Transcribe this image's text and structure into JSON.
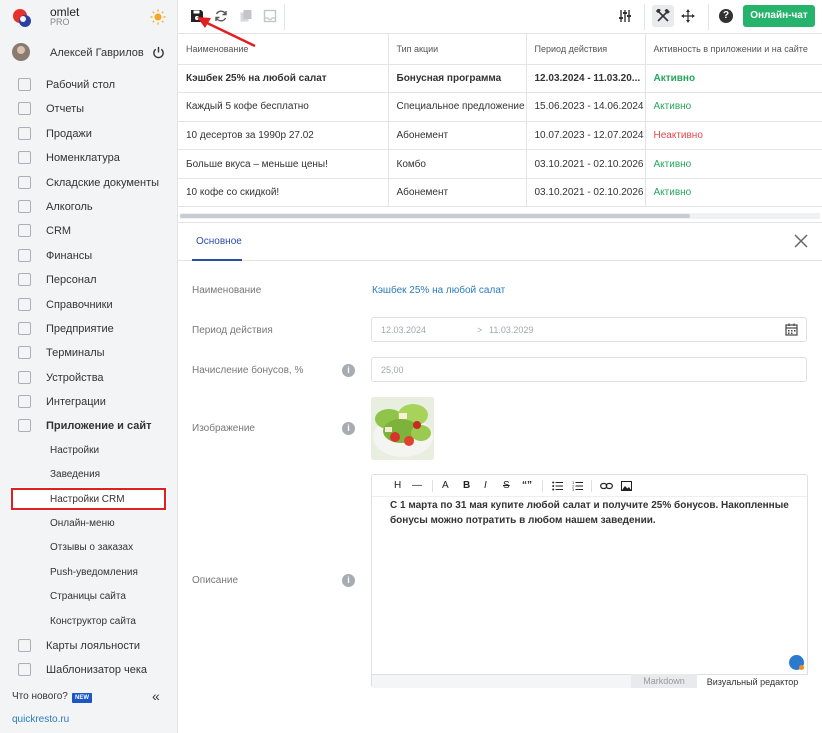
{
  "brand": {
    "name": "omlet",
    "plan": "PRO"
  },
  "user": {
    "name": "Алексей Гаврилов"
  },
  "sidebar": {
    "items": [
      {
        "label": "Рабочий стол",
        "icon": "dashboard-icon"
      },
      {
        "label": "Отчеты",
        "icon": "chart-icon"
      },
      {
        "label": "Продажи",
        "icon": "cart-icon"
      },
      {
        "label": "Номенклатура",
        "icon": "tag-icon"
      },
      {
        "label": "Складские документы",
        "icon": "box-icon"
      },
      {
        "label": "Алкоголь",
        "icon": "glass-icon"
      },
      {
        "label": "CRM",
        "icon": "crm-icon"
      },
      {
        "label": "Финансы",
        "icon": "wallet-icon"
      },
      {
        "label": "Персонал",
        "icon": "people-icon"
      },
      {
        "label": "Справочники",
        "icon": "book-icon"
      },
      {
        "label": "Предприятие",
        "icon": "building-icon"
      },
      {
        "label": "Терминалы",
        "icon": "terminal-icon"
      },
      {
        "label": "Устройства",
        "icon": "printer-icon"
      },
      {
        "label": "Интеграции",
        "icon": "link-icon"
      },
      {
        "label": "Приложение и сайт",
        "icon": "app-icon"
      }
    ],
    "subitems": [
      "Настройки",
      "Заведения",
      "Настройки CRM",
      "Онлайн-меню",
      "Отзывы о заказах",
      "Push-уведомления",
      "Страницы сайта",
      "Конструктор сайта"
    ],
    "active_subitem": "Настройки CRM",
    "bottom_items": [
      {
        "label": "Карты лояльности",
        "icon": "card-icon"
      },
      {
        "label": "Шаблонизатор чека",
        "icon": "receipt-icon"
      }
    ],
    "whats_new": "Что нового?",
    "new_badge": "NEW",
    "site_link": "quickresto.ru"
  },
  "toolbar": {
    "online_chat": "Онлайн-чат",
    "help": "?"
  },
  "table": {
    "headers": [
      "Наименование",
      "Тип акции",
      "Период действия",
      "Активность в приложении и на сайте"
    ],
    "rows": [
      {
        "name": "Кэшбек 25% на любой салат",
        "type": "Бонусная программа",
        "period": "12.03.2024 - 11.03.20...",
        "status": "Активно",
        "active": true,
        "selected": true
      },
      {
        "name": "Каждый 5 кофе бесплатно",
        "type": "Специальное предложение",
        "period": "15.06.2023 - 14.06.2024",
        "status": "Активно",
        "active": true
      },
      {
        "name": "10 десертов за 1990р 27.02",
        "type": "Абонемент",
        "period": "10.07.2023 - 12.07.2024",
        "status": "Неактивно",
        "active": false
      },
      {
        "name": "Больше вкуса – меньше цены!",
        "type": "Комбо",
        "period": "03.10.2021 - 02.10.2026",
        "status": "Активно",
        "active": true
      },
      {
        "name": "10 кофе со скидкой!",
        "type": "Абонемент",
        "period": "03.10.2021 - 02.10.2026",
        "status": "Активно",
        "active": true
      }
    ]
  },
  "detail": {
    "tab": "Основное",
    "fields": {
      "name_label": "Наименование",
      "name_value": "Кэшбек 25% на любой салат",
      "period_label": "Период действия",
      "period_from": "12.03.2024",
      "period_to": "11.03.2029",
      "period_sep": ">",
      "bonus_label": "Начисление бонусов, %",
      "bonus_value": "25,00",
      "image_label": "Изображение",
      "description_label": "Описание"
    },
    "editor": {
      "tools": [
        "H",
        "—",
        "A",
        "B",
        "I",
        "S",
        "“”"
      ],
      "text": "С 1 марта по 31 мая купите любой салат и получите 25% бонусов. Накопленные бонусы можно потратить в любом нашем заведении.",
      "mode_markdown": "Markdown",
      "mode_visual": "Визуальный редактор"
    }
  },
  "colors": {
    "accent_green": "#26b36b",
    "active_status": "#26a65b",
    "inactive_status": "#e0484e",
    "link": "#2a7bbf",
    "highlight_red": "#e02020"
  }
}
